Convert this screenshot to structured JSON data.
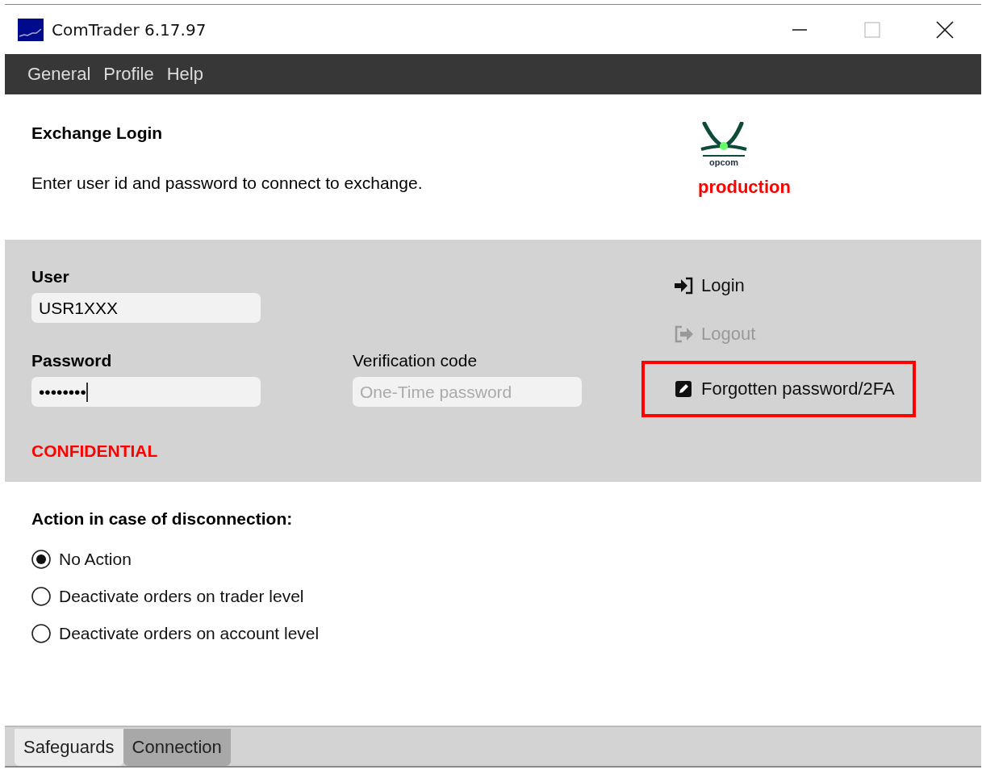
{
  "window": {
    "title": "ComTrader 6.17.97"
  },
  "menu": [
    "General",
    "Profile",
    "Help"
  ],
  "header": {
    "title": "Exchange Login",
    "description": "Enter user id and password to connect to exchange.",
    "logo_text": "opcom",
    "environment": "production"
  },
  "login": {
    "user": {
      "label": "User",
      "value": "USR1XXX"
    },
    "password": {
      "label": "Password",
      "value": "••••••••",
      "focused": true
    },
    "verification": {
      "label": "Verification code",
      "placeholder": "One-Time password"
    },
    "notice": "CONFIDENTIAL",
    "actions": [
      {
        "kind": "login",
        "label": "Login",
        "disabled": false,
        "highlighted": false
      },
      {
        "kind": "logout",
        "label": "Logout",
        "disabled": true,
        "highlighted": false
      },
      {
        "kind": "forgot",
        "label": "Forgotten password/2FA",
        "disabled": false,
        "highlighted": true
      }
    ]
  },
  "disconnection": {
    "title": "Action in case of disconnection:",
    "options": [
      {
        "label": "No Action",
        "selected": true
      },
      {
        "label": "Deactivate orders on trader level",
        "selected": false
      },
      {
        "label": "Deactivate orders on account level",
        "selected": false
      }
    ]
  },
  "tabs": [
    {
      "label": "Safeguards",
      "selected": false
    },
    {
      "label": "Connection",
      "selected": true
    }
  ]
}
